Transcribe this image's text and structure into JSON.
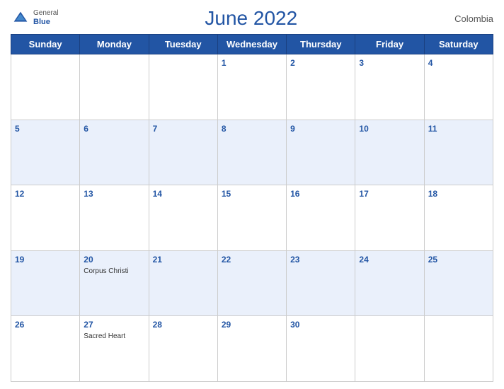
{
  "header": {
    "title": "June 2022",
    "country": "Colombia",
    "logo_general": "General",
    "logo_blue": "Blue"
  },
  "days_of_week": [
    "Sunday",
    "Monday",
    "Tuesday",
    "Wednesday",
    "Thursday",
    "Friday",
    "Saturday"
  ],
  "weeks": [
    [
      {
        "num": "",
        "holiday": ""
      },
      {
        "num": "",
        "holiday": ""
      },
      {
        "num": "",
        "holiday": ""
      },
      {
        "num": "1",
        "holiday": ""
      },
      {
        "num": "2",
        "holiday": ""
      },
      {
        "num": "3",
        "holiday": ""
      },
      {
        "num": "4",
        "holiday": ""
      }
    ],
    [
      {
        "num": "5",
        "holiday": ""
      },
      {
        "num": "6",
        "holiday": ""
      },
      {
        "num": "7",
        "holiday": ""
      },
      {
        "num": "8",
        "holiday": ""
      },
      {
        "num": "9",
        "holiday": ""
      },
      {
        "num": "10",
        "holiday": ""
      },
      {
        "num": "11",
        "holiday": ""
      }
    ],
    [
      {
        "num": "12",
        "holiday": ""
      },
      {
        "num": "13",
        "holiday": ""
      },
      {
        "num": "14",
        "holiday": ""
      },
      {
        "num": "15",
        "holiday": ""
      },
      {
        "num": "16",
        "holiday": ""
      },
      {
        "num": "17",
        "holiday": ""
      },
      {
        "num": "18",
        "holiday": ""
      }
    ],
    [
      {
        "num": "19",
        "holiday": ""
      },
      {
        "num": "20",
        "holiday": "Corpus Christi"
      },
      {
        "num": "21",
        "holiday": ""
      },
      {
        "num": "22",
        "holiday": ""
      },
      {
        "num": "23",
        "holiday": ""
      },
      {
        "num": "24",
        "holiday": ""
      },
      {
        "num": "25",
        "holiday": ""
      }
    ],
    [
      {
        "num": "26",
        "holiday": ""
      },
      {
        "num": "27",
        "holiday": "Sacred Heart"
      },
      {
        "num": "28",
        "holiday": ""
      },
      {
        "num": "29",
        "holiday": ""
      },
      {
        "num": "30",
        "holiday": ""
      },
      {
        "num": "",
        "holiday": ""
      },
      {
        "num": "",
        "holiday": ""
      }
    ]
  ]
}
